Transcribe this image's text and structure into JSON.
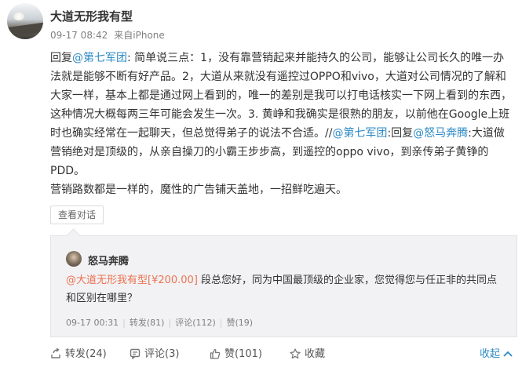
{
  "author": {
    "name": "大道无形我有型",
    "time": "09-17 08:42",
    "source": "来自iPhone"
  },
  "post": {
    "reply_prefix": "回复",
    "mention_1": "@第七军团",
    "seg_1": ": 简单说三点：1，没有靠营销起来并能持久的公司，能够让公司长久的唯一办法就是能够不断有好产品。2，大道从来就没有遥控过OPPO和vivo，大道对公司情况的了解和大家一样，基本上都是通过网上看到的，唯一的差别是我可以打电话核实一下网上看到的东西，这种情况大概每两三年可能会发生一次。3. 黄峥和我确实是很熟的朋友，以前他在Google上班时也确实经常在一起聊天，但总觉得弟子的说法不合适。//",
    "mention_2": "@第七军团",
    "seg_2": ":回复",
    "mention_3": "@怒马奔腾",
    "seg_3": ":大道做营销绝对是顶级的，从亲自操刀的小霸王步步高，到遥控的oppo vivo，到亲传弟子黄铮的PDD。",
    "line_last": "营销路数都是一样的，魔性的广告铺天盖地，一招鲜吃遍天。"
  },
  "view_dialog_label": "查看对话",
  "repost": {
    "name": "怒马奔腾",
    "mention": "@大道无形我有型[¥200.00]",
    "text": " 段总您好，同为中国最顶级的企业家，您觉得您与任正非的共同点和区别在哪里？",
    "time": "09-17 00:31",
    "forward": "转发(81)",
    "comment": "评论(112)",
    "like": "赞(19)"
  },
  "actions": {
    "forward": "转发(24)",
    "comment": "评论(3)",
    "like": "赞(101)",
    "favorite": "收藏",
    "collapse": "收起"
  },
  "colors": {
    "link": "#eb7350",
    "accent": "#2d8ac4",
    "meta": "#808080",
    "repost_bg": "#f2f2f5"
  }
}
